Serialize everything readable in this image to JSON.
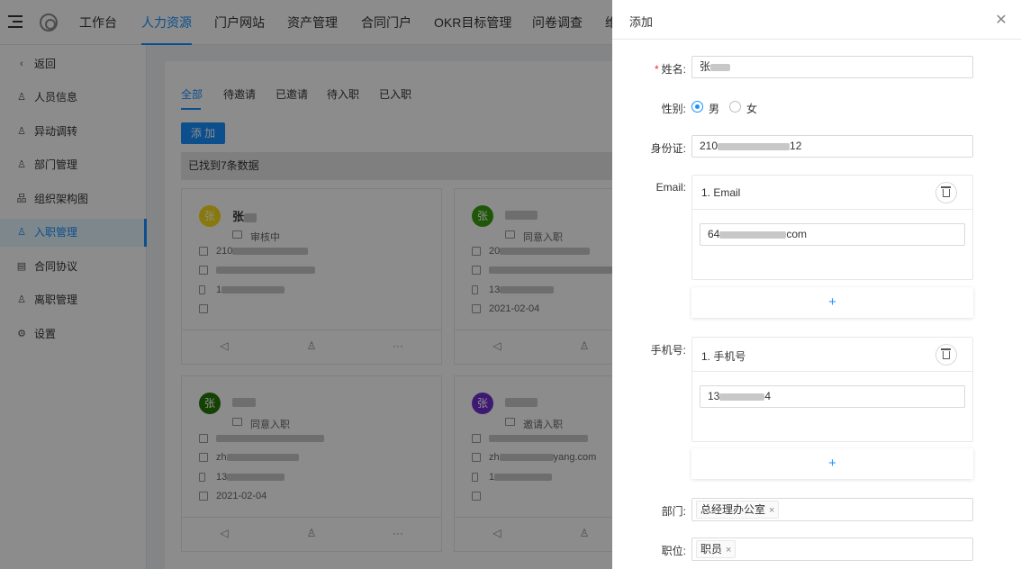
{
  "topnav": {
    "items": [
      "工作台",
      "人力资源",
      "门户网站",
      "资产管理",
      "合同门户",
      "OKR目标管理",
      "问卷调查",
      "维"
    ],
    "active_index": 1
  },
  "sidebar": {
    "items": [
      {
        "label": "返回",
        "icon": "back-arrow-icon"
      },
      {
        "label": "人员信息",
        "icon": "user-icon"
      },
      {
        "label": "异动调转",
        "icon": "user-icon"
      },
      {
        "label": "部门管理",
        "icon": "user-icon"
      },
      {
        "label": "组织架构图",
        "icon": "org-chart-icon"
      },
      {
        "label": "入职管理",
        "icon": "user-icon"
      },
      {
        "label": "合同协议",
        "icon": "document-icon"
      },
      {
        "label": "离职管理",
        "icon": "user-icon"
      },
      {
        "label": "设置",
        "icon": "gear-icon"
      }
    ],
    "active_index": 5
  },
  "main": {
    "tabs": [
      "全部",
      "待邀请",
      "已邀请",
      "待入职",
      "已入职"
    ],
    "add_button": "添 加",
    "result_text": "已找到7条数据",
    "cards": [
      {
        "avatar": "张",
        "avatar_color": "#fadb14",
        "name": "张",
        "status": "审核中",
        "id": "210",
        "email": "",
        "phone": "1",
        "date": ""
      },
      {
        "avatar": "张",
        "avatar_color": "#389e0d",
        "name": "",
        "status": "同意入职",
        "id": "20",
        "email": "",
        "phone": "13",
        "date": "2021-02-04"
      },
      {
        "avatar": "张",
        "avatar_color": "#237804",
        "name": "",
        "status": "同意入职",
        "id": "",
        "email": "zh",
        "phone": "13",
        "date": "2021-02-04"
      },
      {
        "avatar": "张",
        "avatar_color": "#722ed1",
        "name": "",
        "status": "邀请入职",
        "id": "",
        "email": "zh",
        "email_suffix": "yang.com",
        "phone": "1",
        "date": ""
      }
    ]
  },
  "drawer": {
    "title": "添加",
    "close_icon": "close-icon",
    "fields": {
      "name_label": "姓名:",
      "name_value": "张",
      "gender_label": "性别:",
      "gender_male": "男",
      "gender_female": "女",
      "gender_selected": "男",
      "idcard_label": "身份证:",
      "idcard_value": "210",
      "idcard_suffix": "12",
      "email_label": "Email:",
      "email_item_title": "1. Email",
      "email_value": "64",
      "email_suffix": "com",
      "phone_label": "手机号:",
      "phone_item_title": "1. 手机号",
      "phone_value": "13",
      "phone_suffix": "4",
      "add_symbol": "+",
      "dept_label": "部门:",
      "dept_tag": "总经理办公室",
      "position_label": "职位:",
      "position_tag": "职员",
      "tag_remove": "×"
    }
  }
}
